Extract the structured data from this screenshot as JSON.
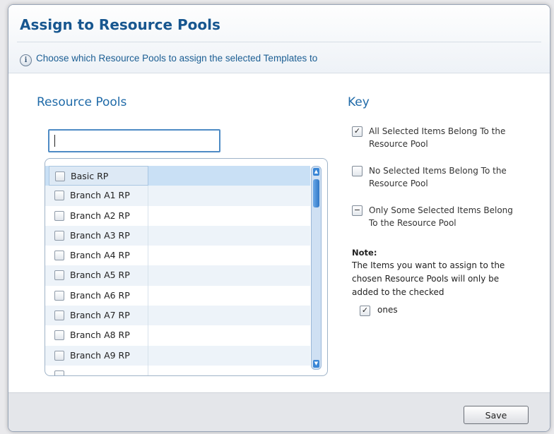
{
  "dialog": {
    "title": "Assign to Resource Pools",
    "subtitle": "Choose which Resource Pools to assign the selected Templates to"
  },
  "resource_pools": {
    "heading": "Resource Pools",
    "search_value": "",
    "items": [
      {
        "label": "Basic RP",
        "checked": false,
        "selected": true
      },
      {
        "label": "Branch A1 RP",
        "checked": false,
        "selected": false
      },
      {
        "label": "Branch A2 RP",
        "checked": false,
        "selected": false
      },
      {
        "label": "Branch A3 RP",
        "checked": false,
        "selected": false
      },
      {
        "label": "Branch A4 RP",
        "checked": false,
        "selected": false
      },
      {
        "label": "Branch A5 RP",
        "checked": false,
        "selected": false
      },
      {
        "label": "Branch A6 RP",
        "checked": false,
        "selected": false
      },
      {
        "label": "Branch A7 RP",
        "checked": false,
        "selected": false
      },
      {
        "label": "Branch A8 RP",
        "checked": false,
        "selected": false
      },
      {
        "label": "Branch A9 RP",
        "checked": false,
        "selected": false
      },
      {
        "label": "",
        "checked": false,
        "selected": false
      }
    ]
  },
  "key": {
    "heading": "Key",
    "items": [
      {
        "state": "checked",
        "text": "All Selected Items Belong To the Resource Pool"
      },
      {
        "state": "unchecked",
        "text": "No Selected Items Belong To the Resource Pool"
      },
      {
        "state": "partial",
        "text": "Only Some Selected Items Belong To the Resource Pool"
      }
    ],
    "note_title": "Note:",
    "note_text": "The Items you want to assign to the chosen Resource Pools will only be added to the checked",
    "note_suffix": "ones"
  },
  "footer": {
    "save_label": "Save"
  },
  "colors": {
    "title": "#17568f",
    "section_heading": "#1f6aa8",
    "selection": "#c9e0f5",
    "scrollbar": "#3a86d6"
  },
  "icons": {
    "info": "info-icon",
    "check": "check-icon",
    "partial": "partial-check-icon"
  }
}
